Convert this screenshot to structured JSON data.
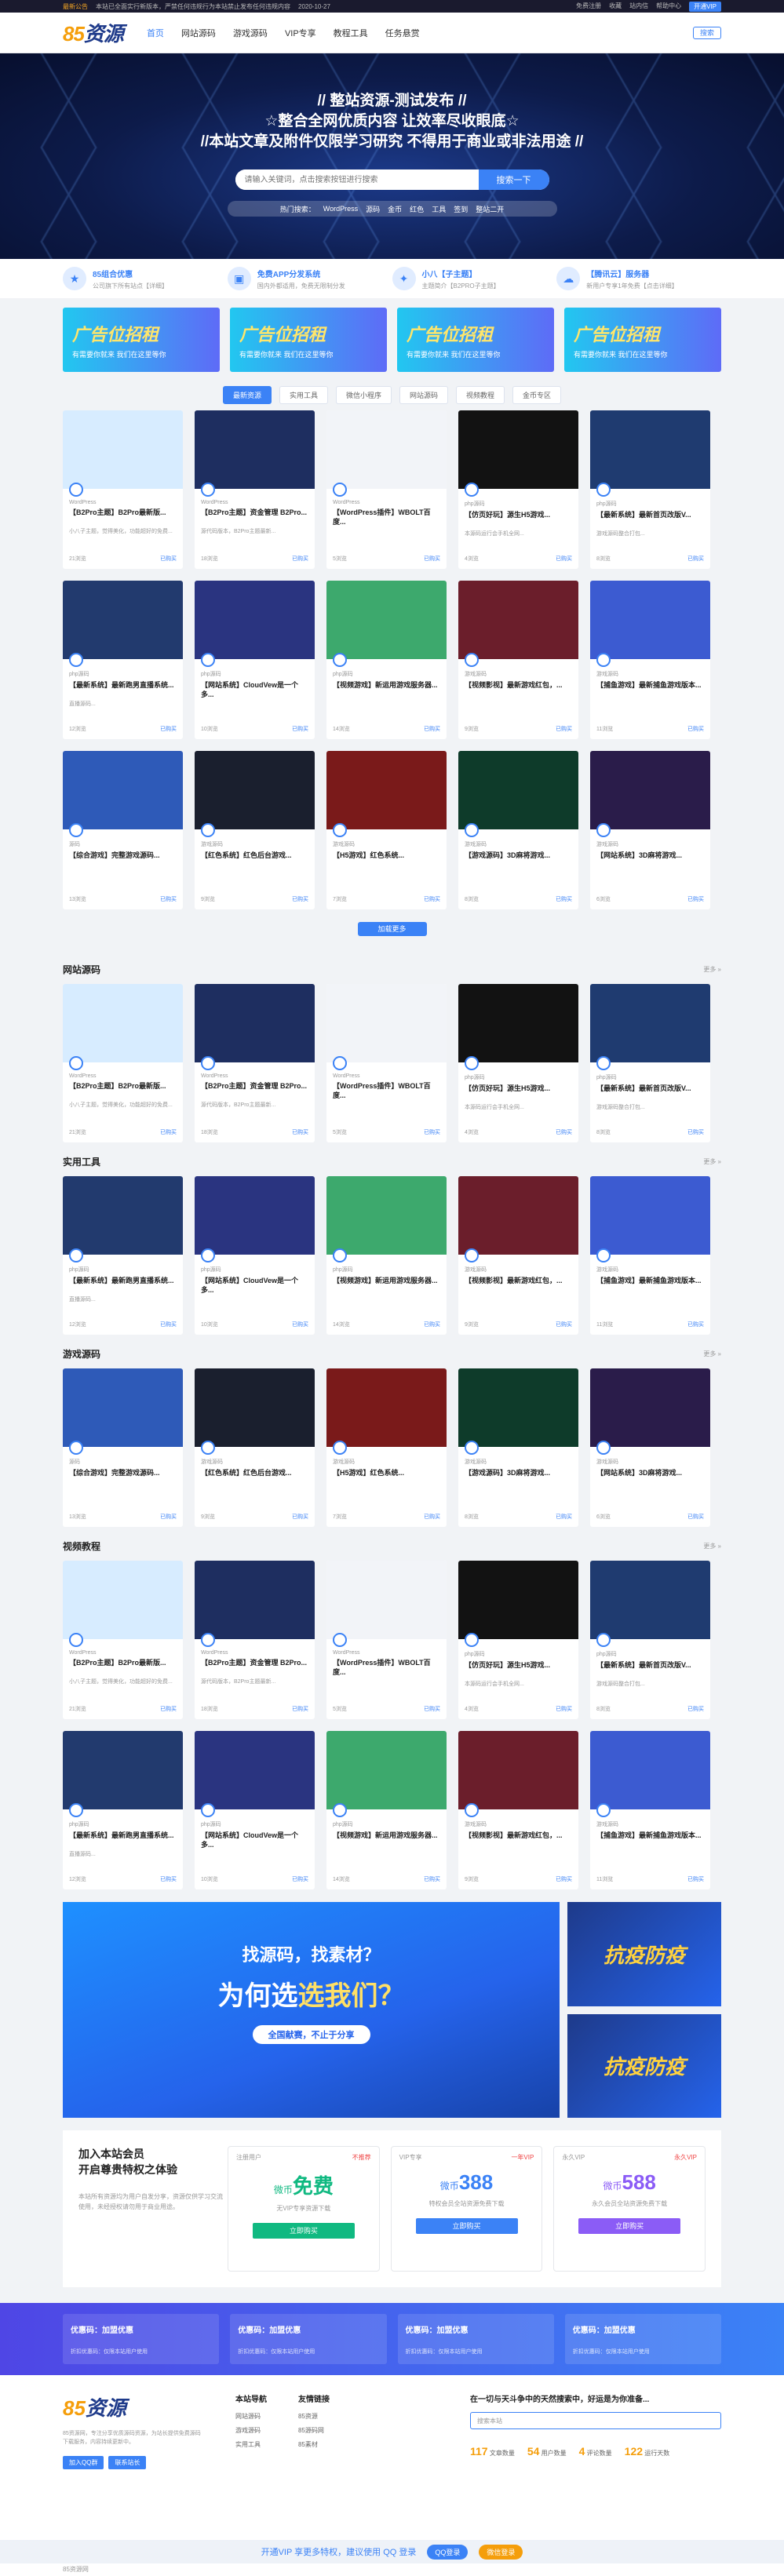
{
  "topbar": {
    "notice": "最新公告",
    "text": "本站已全面实行新版本，严禁任何违规行为本站禁止发布任何违规内容",
    "date": "2020-10-27",
    "links": [
      "免费注册",
      "收藏",
      "站内信",
      "帮助中心",
      "获取更多资源"
    ],
    "vip": "开通VIP"
  },
  "header": {
    "logo_a": "85",
    "logo_b": "资源",
    "nav": [
      "首页",
      "网站源码",
      "游戏源码",
      "VIP专享",
      "教程工具",
      "任务悬赏"
    ],
    "search": "搜索"
  },
  "hero": {
    "line1": "// 整站资源-测试发布 //",
    "line2": "☆整合全网优质内容 让效率尽收眼底☆",
    "line3": "//本站文章及附件仅限学习研究 不得用于商业或非法用途 //",
    "placeholder": "请输入关键词，点击搜索按钮进行搜索",
    "button": "搜索一下",
    "hot": [
      "热门搜索：",
      "WordPress",
      "源码",
      "金币",
      "红色",
      "工具",
      "签到",
      "整站二开"
    ]
  },
  "features": [
    {
      "t": "85组合优惠",
      "d": "公司旗下所有站点【详细】"
    },
    {
      "t": "免费APP分发系统",
      "d": "国内外都适用，免费无限制分发"
    },
    {
      "t": "小八【子主题】",
      "d": "主题简介【B2PRO子主题】"
    },
    {
      "t": "【腾讯云】服务器",
      "d": "新用户专享1年免费【点击详细】"
    }
  ],
  "ads": [
    {
      "t": "广告位招租",
      "d": "有需要你就来 我们在这里等你"
    },
    {
      "t": "广告位招租",
      "d": "有需要你就来 我们在这里等你"
    },
    {
      "t": "广告位招租",
      "d": "有需要你就来 我们在这里等你"
    },
    {
      "t": "广告位招租",
      "d": "有需要你就来 我们在这里等你"
    }
  ],
  "tabs": [
    "最新资源",
    "实用工具",
    "微信小程序",
    "网站源码",
    "视频教程",
    "金币专区"
  ],
  "cards": [
    {
      "cat": "WordPress",
      "t": "【B2Pro主题】B2Pro最新版...",
      "e": "小八子主题，觉得美化，功能超好的免费...",
      "v": "21浏览",
      "p": "已购买",
      "c": "#d7ecff"
    },
    {
      "cat": "WordPress",
      "t": "【B2Pro主题】资金管理 B2Pro...",
      "e": "源代码版本，B2Pro主题最新...",
      "v": "18浏览",
      "p": "已购买",
      "c": "#1e2e60"
    },
    {
      "cat": "WordPress",
      "t": "【WordPress插件】WBOLT百度...",
      "e": "",
      "v": "5浏览",
      "p": "已购买",
      "c": "#f2f4f8"
    },
    {
      "cat": "php源码",
      "t": "【仿页好玩】源生H5游戏...",
      "e": "本源码运行会手机全网...",
      "v": "4浏览",
      "p": "已购买",
      "c": "#121212"
    },
    {
      "cat": "php源码",
      "t": "【最新系统】最新首页改版V...",
      "e": "游戏源码整合打包...",
      "v": "8浏览",
      "p": "已购买",
      "c": "#1f3b70"
    },
    {
      "cat": "php源码",
      "t": "【最新系统】最新跑男直播系统...",
      "e": "直播源码...",
      "v": "12浏览",
      "p": "已购买",
      "c": "#223a6e"
    },
    {
      "cat": "php源码",
      "t": "【网站系统】CloudVew是一个多...",
      "e": "",
      "v": "10浏览",
      "p": "已购买",
      "c": "#2a3480"
    },
    {
      "cat": "php源码",
      "t": "【视频游戏】新运用游戏服务器...",
      "e": "",
      "v": "14浏览",
      "p": "已购买",
      "c": "#3da96d"
    },
    {
      "cat": "游戏源码",
      "t": "【视频影视】最新游戏红包，...",
      "e": "",
      "v": "9浏览",
      "p": "已购买",
      "c": "#6b1e2b"
    },
    {
      "cat": "游戏源码",
      "t": "【捕鱼游戏】最新捕鱼游戏版本...",
      "e": "",
      "v": "11浏览",
      "p": "已购买",
      "c": "#3c5bd1"
    },
    {
      "cat": "源码",
      "t": "【综合游戏】完整游戏源码...",
      "e": "",
      "v": "13浏览",
      "p": "已购买",
      "c": "#2e5ab8"
    },
    {
      "cat": "游戏源码",
      "t": "【红色系统】红色后台游戏...",
      "e": "",
      "v": "9浏览",
      "p": "已购买",
      "c": "#1a1f2e"
    },
    {
      "cat": "游戏源码",
      "t": "【H5游戏】红色系统...",
      "e": "",
      "v": "7浏览",
      "p": "已购买",
      "c": "#7a1a1a"
    },
    {
      "cat": "游戏源码",
      "t": "【游戏源码】3D麻将游戏...",
      "e": "",
      "v": "8浏览",
      "p": "已购买",
      "c": "#0e3b2a"
    },
    {
      "cat": "游戏源码",
      "t": "【网站系统】3D麻将游戏...",
      "e": "",
      "v": "6浏览",
      "p": "已购买",
      "c": "#2a1c4a"
    }
  ],
  "more": "加载更多",
  "sections": [
    "网站源码",
    "实用工具",
    "游戏源码",
    "视频教程"
  ],
  "more_link": "更多 »",
  "banner": {
    "b1": "找源码，找素材？",
    "b2a": "为何选",
    "b2b": "选我们？",
    "b3": "全国献赛，不止于分享",
    "side1": "抗疫防疫",
    "side2": "抗疫防疫"
  },
  "vip": {
    "title1": "加入本站会员",
    "title2": "开启尊贵特权之体验",
    "desc": "本站所有资源均为用户自发分享，资源仅供学习交流使用，未经授权请勿用于商业用途。",
    "plans": [
      {
        "pl": "注册用户",
        "tag": "不推荐",
        "price": "免费",
        "pre": "微币",
        "d": "无VIP专享资源下载",
        "btn": "立即购买",
        "bc": "#10b981"
      },
      {
        "pl": "VIP专享",
        "tag": "一年VIP",
        "price": "388",
        "pre": "微币",
        "d": "特权会员全站资源免费下载",
        "btn": "立即购买",
        "bc": "#3b82f6"
      },
      {
        "pl": "永久VIP",
        "tag": "永久VIP",
        "price": "588",
        "pre": "微币",
        "d": "永久会员全站资源免费下载",
        "btn": "立即购买",
        "bc": "#8b5cf6"
      }
    ]
  },
  "strip": [
    {
      "t": "优惠码：加盟优惠",
      "d": "折扣优惠码：仅限本站用户使用"
    },
    {
      "t": "优惠码：加盟优惠",
      "d": "折扣优惠码：仅限本站用户使用"
    },
    {
      "t": "优惠码：加盟优惠",
      "d": "折扣优惠码：仅限本站用户使用"
    },
    {
      "t": "优惠码：加盟优惠",
      "d": "折扣优惠码：仅限本站用户使用"
    }
  ],
  "footer": {
    "about": "85资源网，专注分享优质源码资源，为站长提供免费源码下载服务，内容持续更新中。",
    "btn1": "加入QQ群",
    "btn2": "联系站长",
    "nav_t": "本站导航",
    "nav": [
      "网站源码",
      "游戏源码",
      "实用工具"
    ],
    "link_t": "友情链接",
    "links": [
      "85资源",
      "85源码网",
      "85素材"
    ],
    "qr_t": "在一切与天斗争中的天然搜索中，好运是为你准备...",
    "search": "搜索本站",
    "stats": [
      {
        "n": "117",
        "l": "文章数量"
      },
      {
        "n": "54",
        "l": "用户数量"
      },
      {
        "n": "4",
        "l": "评论数量"
      },
      {
        "n": "122",
        "l": "运行天数"
      }
    ]
  },
  "bottombar": {
    "t": "开通VIP 享更多特权，建议使用 QQ 登录",
    "b1": "QQ登录",
    "b2": "微信登录"
  },
  "copy": "85资源网"
}
